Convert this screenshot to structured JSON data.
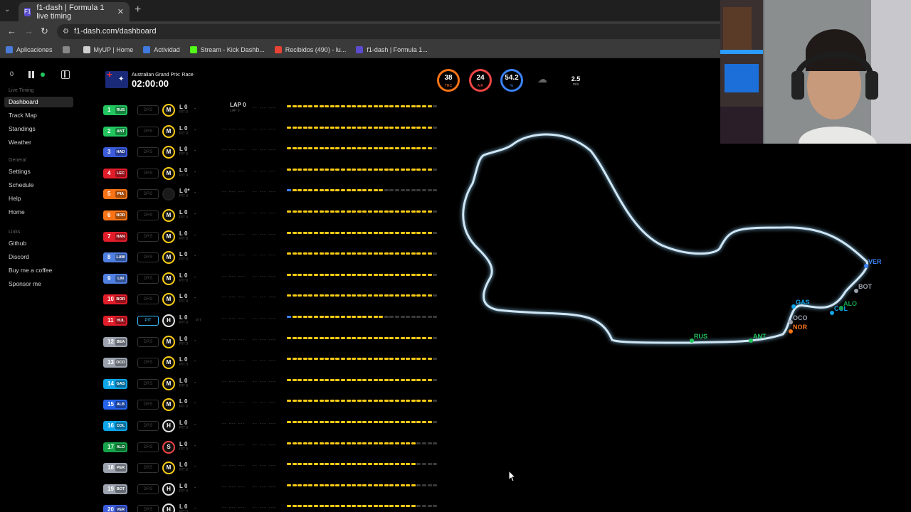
{
  "browser": {
    "tab_title": "f1-dash | Formula 1 live timing",
    "tab_icon": "F1",
    "url": "f1-dash.com/dashboard",
    "bookmarks": [
      {
        "label": "Aplicaciones",
        "color": "#4b7bd8"
      },
      {
        "label": "",
        "color": "#888888"
      },
      {
        "label": "MyUP | Home",
        "color": "#d0d0d0"
      },
      {
        "label": "Actividad",
        "color": "#3f7be0"
      },
      {
        "label": "Stream - Kick Dashb...",
        "color": "#53fc18"
      },
      {
        "label": "Recibidos (490) - lu...",
        "color": "#ea4335"
      },
      {
        "label": "f1-dash | Formula 1...",
        "color": "#5b4bcf"
      }
    ]
  },
  "sidebar": {
    "delay": "0",
    "sections": [
      {
        "title": "Live Timing",
        "items": [
          "Dashboard",
          "Track Map",
          "Standings",
          "Weather"
        ]
      },
      {
        "title": "General",
        "items": [
          "Settings",
          "Schedule",
          "Help",
          "Home"
        ]
      },
      {
        "title": "Links",
        "items": [
          "Github",
          "Discord",
          "Buy me a coffee",
          "Sponsor me"
        ]
      }
    ],
    "active": "Dashboard"
  },
  "header": {
    "event": "Australian Grand Prix: Race",
    "clock": "02:00:00"
  },
  "weather": {
    "track_temp": {
      "value": "38",
      "label": "TRC",
      "color": "#f97316"
    },
    "air_temp": {
      "value": "24",
      "label": "AIR",
      "color": "#ef4444"
    },
    "humidity": {
      "value": "54.2",
      "label": "%",
      "color": "#3b82f6"
    },
    "rain_icon": "rain-cloud-icon",
    "wind": {
      "value": "2.5",
      "unit": "m/s",
      "dir": "E"
    }
  },
  "lap_header": {
    "lap": "LAP 0",
    "sub": "LAP 0"
  },
  "drivers": [
    {
      "pos": "1",
      "tla": "RUS",
      "color": "#22c55e",
      "tyre": "M",
      "drs": "DRS"
    },
    {
      "pos": "2",
      "tla": "ANT",
      "color": "#22c55e",
      "tyre": "M",
      "drs": "DRS"
    },
    {
      "pos": "3",
      "tla": "HAD",
      "color": "#3b5bdb",
      "tyre": "M",
      "drs": "DRS"
    },
    {
      "pos": "4",
      "tla": "LEC",
      "color": "#e11d2a",
      "tyre": "M",
      "drs": "DRS"
    },
    {
      "pos": "5",
      "tla": "PIA",
      "color": "#f97316",
      "tyre": "",
      "drs": "DRS"
    },
    {
      "pos": "6",
      "tla": "NOR",
      "color": "#f97316",
      "tyre": "M",
      "drs": "DRS"
    },
    {
      "pos": "7",
      "tla": "HAN",
      "color": "#e11d2a",
      "tyre": "M",
      "drs": "DRS"
    },
    {
      "pos": "8",
      "tla": "LAW",
      "color": "#4f7fe0",
      "tyre": "M",
      "drs": "DRS"
    },
    {
      "pos": "9",
      "tla": "LIN",
      "color": "#4f7fe0",
      "tyre": "M",
      "drs": "DRS"
    },
    {
      "pos": "10",
      "tla": "BOR",
      "color": "#e11d2a",
      "tyre": "M",
      "drs": "DRS"
    },
    {
      "pos": "11",
      "tla": "HUL",
      "color": "#e11d2a",
      "tyre": "H",
      "drs": "PIT"
    },
    {
      "pos": "12",
      "tla": "BEA",
      "color": "#9ca3af",
      "tyre": "M",
      "drs": "DRS"
    },
    {
      "pos": "13",
      "tla": "OCO",
      "color": "#9ca3af",
      "tyre": "M",
      "drs": "DRS"
    },
    {
      "pos": "14",
      "tla": "GAS",
      "color": "#0ea5e9",
      "tyre": "M",
      "drs": "DRS"
    },
    {
      "pos": "15",
      "tla": "ALB",
      "color": "#2563eb",
      "tyre": "M",
      "drs": "DRS"
    },
    {
      "pos": "16",
      "tla": "COL",
      "color": "#0ea5e9",
      "tyre": "H",
      "drs": "DRS"
    },
    {
      "pos": "17",
      "tla": "ALO",
      "color": "#16a34a",
      "tyre": "S",
      "drs": "DRS"
    },
    {
      "pos": "18",
      "tla": "PER",
      "color": "#9ca3af",
      "tyre": "M",
      "drs": "DRS"
    },
    {
      "pos": "19",
      "tla": "BOT",
      "color": "#9ca3af",
      "tyre": "H",
      "drs": "DRS"
    },
    {
      "pos": "20",
      "tla": "VER",
      "color": "#3b5bdb",
      "tyre": "H",
      "drs": "DRS"
    }
  ],
  "row_texts": {
    "lap": "L 0",
    "pit": "PIT 0",
    "lap_star": "L 0*",
    "pit_label": "PIT",
    "tick": "-",
    "blank": "-- --- ---"
  },
  "track_labels": [
    {
      "tla": "RUS",
      "color": "#22c55e"
    },
    {
      "tla": "ANT",
      "color": "#22c55e"
    },
    {
      "tla": "GAS",
      "color": "#0ea5e9"
    },
    {
      "tla": "OCO",
      "color": "#9ca3af"
    },
    {
      "tla": "NOR",
      "color": "#f97316"
    },
    {
      "tla": "COL",
      "color": "#0ea5e9"
    },
    {
      "tla": "ALO",
      "color": "#16a34a"
    },
    {
      "tla": "VER",
      "color": "#3b82f6"
    },
    {
      "tla": "BOT",
      "color": "#9ca3af"
    }
  ]
}
